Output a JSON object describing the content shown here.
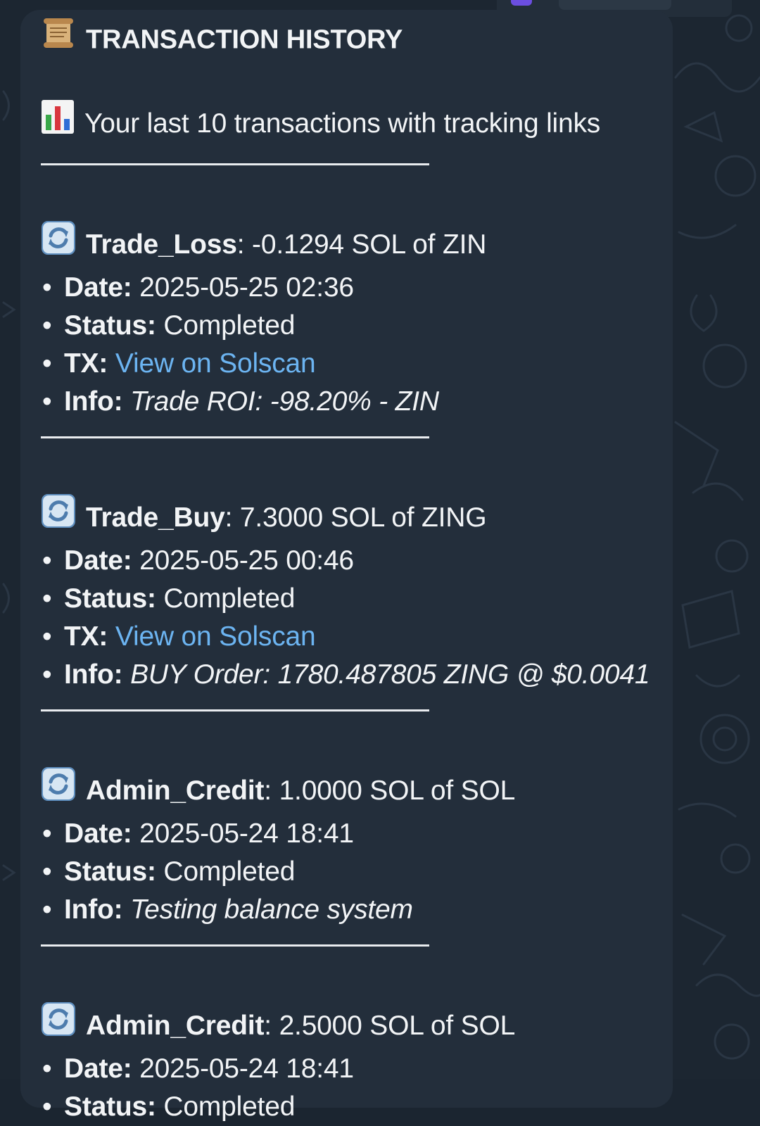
{
  "header": {
    "title": "TRANSACTION HISTORY",
    "subtitle": "Your last 10 transactions with tracking links",
    "title_icon": "scroll-icon",
    "subtitle_icon": "bar-chart-icon"
  },
  "labels": {
    "date": "Date:",
    "status": "Status:",
    "tx": "TX:",
    "info": "Info:"
  },
  "transactions": [
    {
      "type": "Trade_Loss",
      "amount": ": -0.1294 SOL of ZIN",
      "date": "2025-05-25 02:36",
      "status": "Completed",
      "tx_link": "View on Solscan",
      "info": "Trade ROI: -98.20% - ZIN"
    },
    {
      "type": "Trade_Buy",
      "amount": ": 7.3000 SOL of ZING",
      "date": "2025-05-25 00:46",
      "status": "Completed",
      "tx_link": "View on Solscan",
      "info": "BUY Order: 1780.487805 ZING @ $0.0041"
    },
    {
      "type": "Admin_Credit",
      "amount": ": 1.0000 SOL of SOL",
      "date": "2025-05-24 18:41",
      "status": "Completed",
      "info": "Testing balance system"
    },
    {
      "type": "Admin_Credit",
      "amount": ": 2.5000 SOL of SOL",
      "date": "2025-05-24 18:41",
      "status": "Completed"
    }
  ],
  "colors": {
    "bubble": "#232e3b",
    "background": "#1c2631",
    "link": "#6cb4f1",
    "text": "#f2f4f6"
  }
}
